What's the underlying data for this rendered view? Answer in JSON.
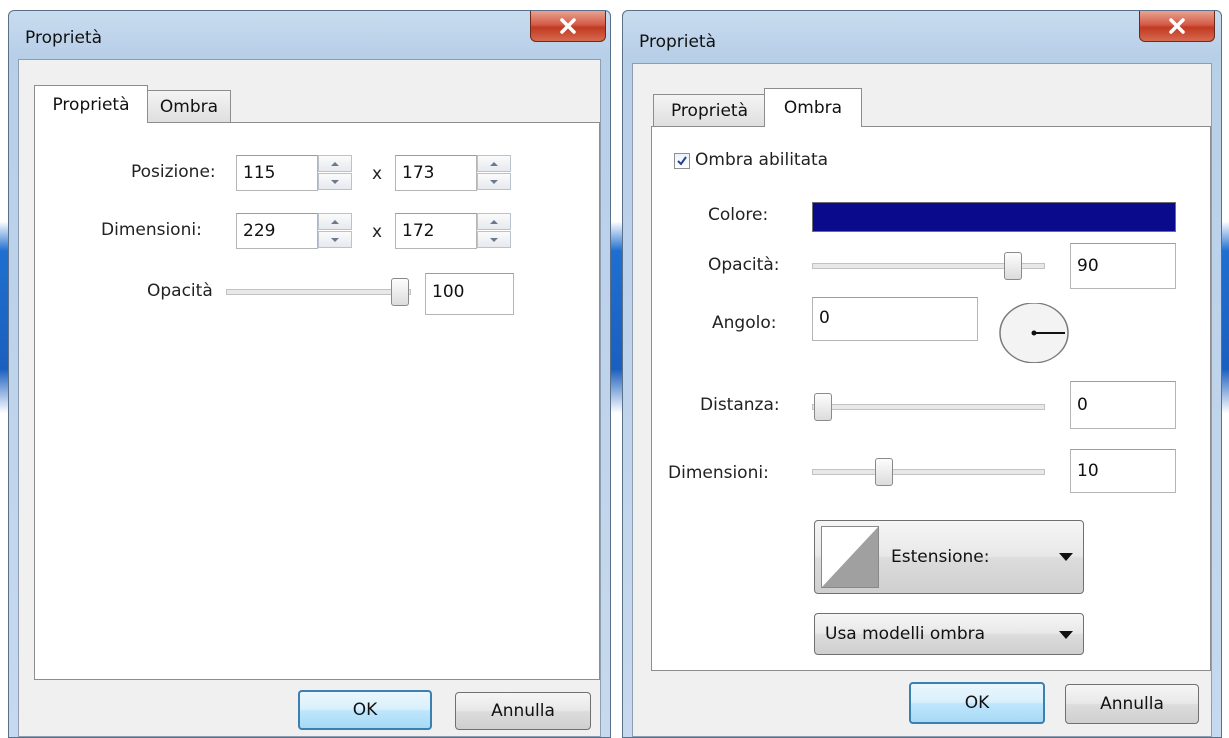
{
  "left_dialog": {
    "title": "Proprietà",
    "tabs": [
      {
        "label": "Proprietà"
      },
      {
        "label": "Ombra"
      }
    ],
    "position": {
      "label": "Posizione:",
      "x": "115",
      "y": "173",
      "separator": "x"
    },
    "size": {
      "label": "Dimensioni:",
      "x": "229",
      "y": "172",
      "separator": "x"
    },
    "opacity": {
      "label": "Opacità",
      "value": "100",
      "level": 1.0
    },
    "ok_label": "OK",
    "cancel_label": "Annulla"
  },
  "right_dialog": {
    "title": "Proprietà",
    "tabs": [
      {
        "label": "Proprietà"
      },
      {
        "label": "Ombra"
      }
    ],
    "shadow_enabled": {
      "label": "Ombra abilitata",
      "checked": true
    },
    "color": {
      "label": "Colore:",
      "value": "#0a0a8c"
    },
    "opacity": {
      "label": "Opacità:",
      "value": "90",
      "level": 0.9
    },
    "angle": {
      "label": "Angolo:",
      "value": "0"
    },
    "distance": {
      "label": "Distanza:",
      "value": "0",
      "level": 0.0
    },
    "size": {
      "label": "Dimensioni:",
      "value": "10",
      "level": 0.3
    },
    "extension_button": {
      "label": "Estensione:"
    },
    "templates_button": {
      "label": "Usa modelli ombra"
    },
    "ok_label": "OK",
    "cancel_label": "Annulla"
  },
  "icons": {
    "close": "close-x-icon",
    "spin_up": "chevron-up-icon",
    "spin_down": "chevron-down-icon",
    "dropdown": "caret-down-icon",
    "check": "check-icon"
  }
}
